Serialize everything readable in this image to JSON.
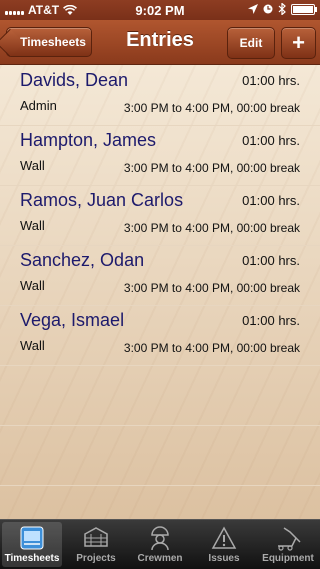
{
  "status_bar": {
    "carrier": "AT&T",
    "time": "9:02 PM"
  },
  "nav": {
    "back_label": "Timesheets",
    "title": "Entries",
    "edit_label": "Edit",
    "add_label": "+"
  },
  "entries": [
    {
      "name": "Davids, Dean",
      "hours": "01:00 hrs.",
      "task": "Admin",
      "time": "3:00 PM to 4:00 PM, 00:00 break"
    },
    {
      "name": "Hampton, James",
      "hours": "01:00 hrs.",
      "task": "Wall",
      "time": "3:00 PM to 4:00 PM, 00:00 break"
    },
    {
      "name": "Ramos, Juan Carlos",
      "hours": "01:00 hrs.",
      "task": "Wall",
      "time": "3:00 PM to 4:00 PM, 00:00 break"
    },
    {
      "name": "Sanchez, Odan",
      "hours": "01:00 hrs.",
      "task": "Wall",
      "time": "3:00 PM to 4:00 PM, 00:00 break"
    },
    {
      "name": "Vega, Ismael",
      "hours": "01:00 hrs.",
      "task": "Wall",
      "time": "3:00 PM to 4:00 PM, 00:00 break"
    }
  ],
  "tabs": [
    {
      "label": "Timesheets",
      "icon": "timesheets-icon",
      "active": true
    },
    {
      "label": "Projects",
      "icon": "projects-icon",
      "active": false
    },
    {
      "label": "Crewmen",
      "icon": "crewmen-icon",
      "active": false
    },
    {
      "label": "Issues",
      "icon": "issues-icon",
      "active": false
    },
    {
      "label": "Equipment",
      "icon": "equipment-icon",
      "active": false
    }
  ],
  "colors": {
    "nav_bar": "#9a4524",
    "name_text": "#1d1a6c",
    "tab_bar": "#1a1a1a"
  }
}
